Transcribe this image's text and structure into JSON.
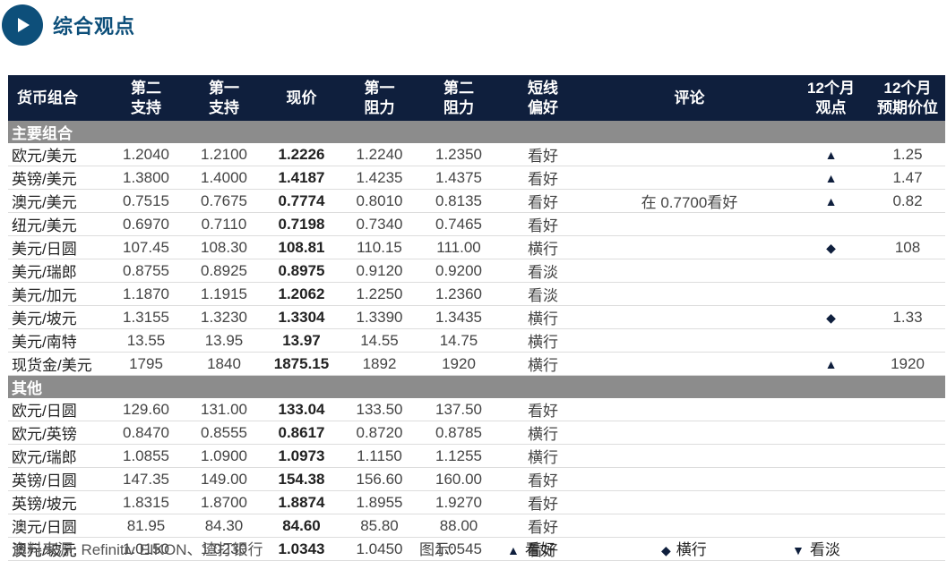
{
  "title": "综合观点",
  "headers": {
    "pair": "货币组合",
    "s2": [
      "第二",
      "支持"
    ],
    "s1": [
      "第一",
      "支持"
    ],
    "spot": "现价",
    "r1": [
      "第一",
      "阻力"
    ],
    "r2": [
      "第二",
      "阻力"
    ],
    "bias": [
      "短线",
      "偏好"
    ],
    "comment": "评论",
    "view12": [
      "12个月",
      "观点"
    ],
    "target12": [
      "12个月",
      "预期价位"
    ]
  },
  "groups": [
    {
      "label": "主要组合",
      "rows": [
        {
          "pair": "欧元/美元",
          "s2": "1.2040",
          "s1": "1.2100",
          "spot": "1.2226",
          "r1": "1.2240",
          "r2": "1.2350",
          "bias": "看好",
          "comment": "",
          "view": "up",
          "target": "1.25"
        },
        {
          "pair": "英镑/美元",
          "s2": "1.3800",
          "s1": "1.4000",
          "spot": "1.4187",
          "r1": "1.4235",
          "r2": "1.4375",
          "bias": "看好",
          "comment": "",
          "view": "up",
          "target": "1.47"
        },
        {
          "pair": "澳元/美元",
          "s2": "0.7515",
          "s1": "0.7675",
          "spot": "0.7774",
          "r1": "0.8010",
          "r2": "0.8135",
          "bias": "看好",
          "comment": "在 0.7700看好",
          "view": "up",
          "target": "0.82"
        },
        {
          "pair": "纽元/美元",
          "s2": "0.6970",
          "s1": "0.7110",
          "spot": "0.7198",
          "r1": "0.7340",
          "r2": "0.7465",
          "bias": "看好",
          "comment": "",
          "view": "",
          "target": ""
        },
        {
          "pair": "美元/日圆",
          "s2": "107.45",
          "s1": "108.30",
          "spot": "108.81",
          "r1": "110.15",
          "r2": "111.00",
          "bias": "横行",
          "comment": "",
          "view": "flat",
          "target": "108"
        },
        {
          "pair": "美元/瑞郎",
          "s2": "0.8755",
          "s1": "0.8925",
          "spot": "0.8975",
          "r1": "0.9120",
          "r2": "0.9200",
          "bias": "看淡",
          "comment": "",
          "view": "",
          "target": ""
        },
        {
          "pair": "美元/加元",
          "s2": "1.1870",
          "s1": "1.1915",
          "spot": "1.2062",
          "r1": "1.2250",
          "r2": "1.2360",
          "bias": "看淡",
          "comment": "",
          "view": "",
          "target": ""
        },
        {
          "pair": "美元/坡元",
          "s2": "1.3155",
          "s1": "1.3230",
          "spot": "1.3304",
          "r1": "1.3390",
          "r2": "1.3435",
          "bias": "横行",
          "comment": "",
          "view": "flat",
          "target": "1.33"
        },
        {
          "pair": "美元/南特",
          "s2": "13.55",
          "s1": "13.95",
          "spot": "13.97",
          "r1": "14.55",
          "r2": "14.75",
          "bias": "横行",
          "comment": "",
          "view": "",
          "target": ""
        },
        {
          "pair": "现货金/美元",
          "s2": "1795",
          "s1": "1840",
          "spot": "1875.15",
          "r1": "1892",
          "r2": "1920",
          "bias": "横行",
          "comment": "",
          "view": "up",
          "target": "1920"
        }
      ]
    },
    {
      "label": "其他",
      "rows": [
        {
          "pair": "欧元/日圆",
          "s2": "129.60",
          "s1": "131.00",
          "spot": "133.04",
          "r1": "133.50",
          "r2": "137.50",
          "bias": "看好",
          "comment": "",
          "view": "",
          "target": ""
        },
        {
          "pair": "欧元/英镑",
          "s2": "0.8470",
          "s1": "0.8555",
          "spot": "0.8617",
          "r1": "0.8720",
          "r2": "0.8785",
          "bias": "横行",
          "comment": "",
          "view": "",
          "target": ""
        },
        {
          "pair": "欧元/瑞郎",
          "s2": "1.0855",
          "s1": "1.0900",
          "spot": "1.0973",
          "r1": "1.1150",
          "r2": "1.1255",
          "bias": "横行",
          "comment": "",
          "view": "",
          "target": ""
        },
        {
          "pair": "英镑/日圆",
          "s2": "147.35",
          "s1": "149.00",
          "spot": "154.38",
          "r1": "156.60",
          "r2": "160.00",
          "bias": "看好",
          "comment": "",
          "view": "",
          "target": ""
        },
        {
          "pair": "英镑/坡元",
          "s2": "1.8315",
          "s1": "1.8700",
          "spot": "1.8874",
          "r1": "1.8955",
          "r2": "1.9270",
          "bias": "看好",
          "comment": "",
          "view": "",
          "target": ""
        },
        {
          "pair": "澳元/日圆",
          "s2": "81.95",
          "s1": "84.30",
          "spot": "84.60",
          "r1": "85.80",
          "r2": "88.00",
          "bias": "看好",
          "comment": "",
          "view": "",
          "target": ""
        },
        {
          "pair": "澳元/坡元",
          "s2": "1.0150",
          "s1": "1.0230",
          "spot": "1.0343",
          "r1": "1.0450",
          "r2": "1.0545",
          "bias": "看好",
          "comment": "",
          "view": "",
          "target": ""
        }
      ]
    }
  ],
  "bias_colors": {
    "看好": "#5aa845",
    "横行": "#e6a817",
    "看淡": "#c0282d"
  },
  "view_symbols": {
    "up": "▲",
    "flat": "◆",
    "down": "▼"
  },
  "footer": {
    "source": "资料来源: Refinitiv EIKON、渣打银行",
    "legend_label": "图示:",
    "legend": [
      {
        "symbol": "▲",
        "label": "看好"
      },
      {
        "symbol": "◆",
        "label": "横行"
      },
      {
        "symbol": "▼",
        "label": "看淡"
      }
    ]
  }
}
